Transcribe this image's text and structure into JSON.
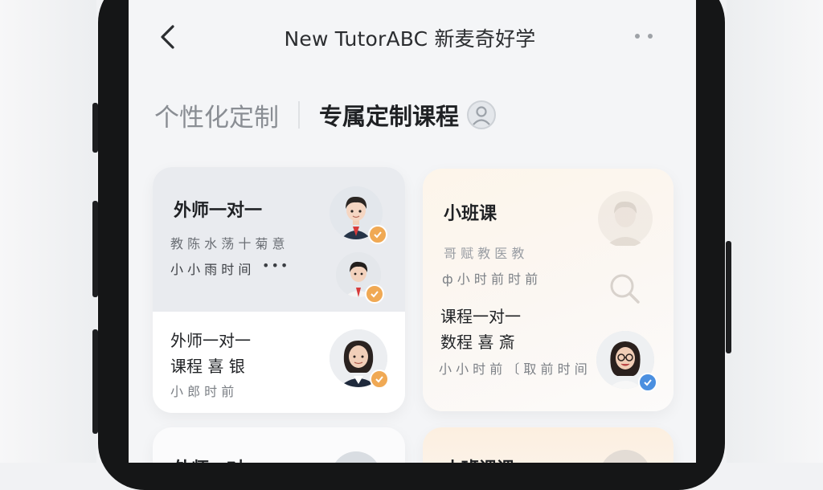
{
  "header": {
    "back_icon": "chevron-left-icon",
    "title": "New TutorABC 新麦奇好学",
    "more_icon": "more-dots-icon"
  },
  "tabs": [
    {
      "label": "个性化定制",
      "active": false
    },
    {
      "label": "专属定制课程",
      "active": true,
      "icon": "person-icon"
    }
  ],
  "cards": {
    "a": {
      "title": "外师一对一",
      "line1": " 教 陈 水 荡 十 菊 意",
      "line2": "小 小 雨 时 间",
      "bottom_title1": "外师一对一",
      "bottom_title2": "课程 喜 银",
      "bottom_sub": "小 郎 时 前"
    },
    "b": {
      "title": "小班课",
      "line1": "哥 赋 教 医 教",
      "line2": "ф 小 时 前 时 前",
      "bottom_title1": "课程一对一",
      "bottom_title2": "数程 喜 斎",
      "bottom_sub": "小 小 时 前 〔 取 前 时 间"
    },
    "c": {
      "title": "外师一对"
    },
    "d": {
      "title": "小班课课"
    }
  },
  "colors": {
    "badge_orange": "#f0a954",
    "badge_blue": "#4a8fe0",
    "card_warm": "#fdf5ea"
  }
}
